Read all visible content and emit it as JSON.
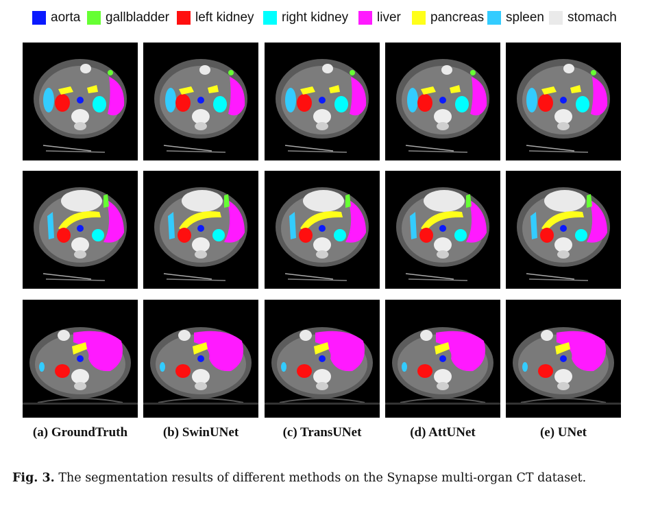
{
  "legend": [
    {
      "label": "aorta",
      "color": "#0a1aff"
    },
    {
      "label": "gallbladder",
      "color": "#66ff33"
    },
    {
      "label": "left kidney",
      "color": "#ff0f0f"
    },
    {
      "label": "right kidney",
      "color": "#00ffff"
    },
    {
      "label": "liver",
      "color": "#ff1aff"
    },
    {
      "label": "pancreas",
      "color": "#ffff1a"
    },
    {
      "label": "spleen",
      "color": "#33ccff"
    },
    {
      "label": "stomach",
      "color": "#eaeaea"
    }
  ],
  "columns": [
    {
      "label": "(a) GroundTruth"
    },
    {
      "label": "(b) SwinUNet"
    },
    {
      "label": "(c) TransUNet"
    },
    {
      "label": "(d) AttUNet"
    },
    {
      "label": "(e) UNet"
    }
  ],
  "caption": {
    "label": "Fig. 3.",
    "text": "The segmentation results of different methods on the Synapse multi-organ CT dataset."
  }
}
